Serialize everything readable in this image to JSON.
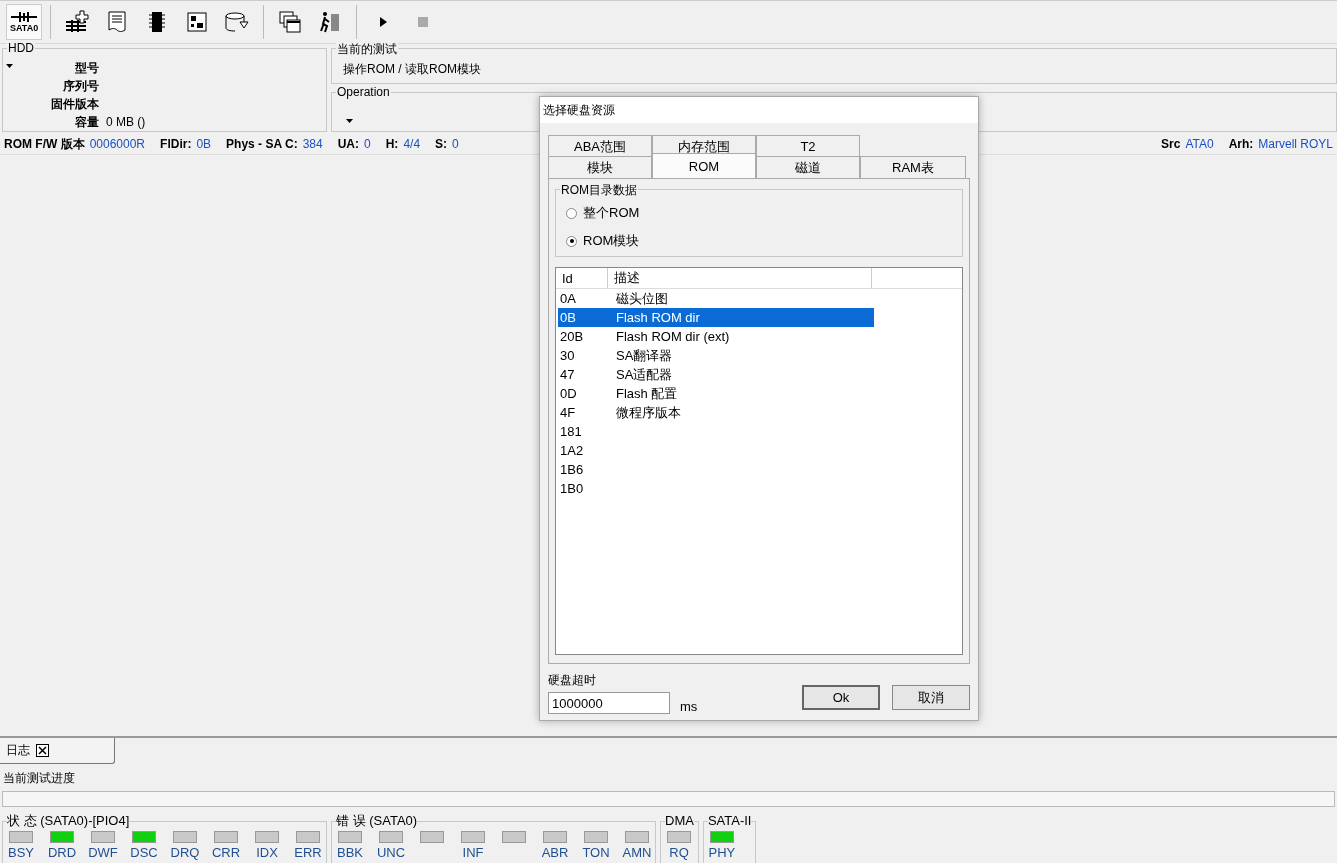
{
  "toolbar": {
    "port_label": "SATA0"
  },
  "hdd": {
    "title": "HDD",
    "fields": [
      {
        "label": "型号"
      },
      {
        "label": "序列号"
      },
      {
        "label": "固件版本"
      },
      {
        "label": "容量",
        "value": "0 MB ()"
      }
    ]
  },
  "current_test": {
    "title": "当前的测试",
    "value": "操作ROM / 读取ROM模块"
  },
  "operation": {
    "title": "Operation"
  },
  "info_bar": {
    "left": [
      {
        "label": "ROM F/W 版本",
        "value": "0006000R"
      },
      {
        "label": "FlDir:",
        "value": "0B"
      },
      {
        "label": "Phys - SA C:",
        "value": "384"
      },
      {
        "label": "UA:",
        "value": "0"
      },
      {
        "label": "H:",
        "value": "4/4"
      },
      {
        "label": "S:",
        "value": "0"
      }
    ],
    "right": [
      {
        "label": "Src",
        "value": "ATA0"
      },
      {
        "label": "Arh:",
        "value": "Marvell ROYL"
      }
    ]
  },
  "dialog": {
    "title": "选择硬盘资源",
    "tab_rows": [
      [
        {
          "label": "ABA范围",
          "selected": false
        },
        {
          "label": "内存范围",
          "selected": false
        },
        {
          "label": "T2",
          "selected": false
        }
      ],
      [
        {
          "label": "模块",
          "selected": false
        },
        {
          "label": "ROM",
          "selected": true
        },
        {
          "label": "磁道",
          "selected": false
        },
        {
          "label": "RAM表",
          "selected": false
        }
      ]
    ],
    "group": {
      "title": "ROM目录数据",
      "options": [
        {
          "label": "整个ROM",
          "selected": false
        },
        {
          "label": "ROM模块",
          "selected": true
        }
      ]
    },
    "list": {
      "columns": [
        "Id",
        "描述"
      ],
      "rows": [
        {
          "id": "0A",
          "desc": "磁头位图",
          "selected": false
        },
        {
          "id": "0B",
          "desc": "Flash ROM dir",
          "selected": true
        },
        {
          "id": "20B",
          "desc": "Flash ROM dir (ext)",
          "selected": false
        },
        {
          "id": "30",
          "desc": "SA翻译器",
          "selected": false
        },
        {
          "id": "47",
          "desc": "SA适配器",
          "selected": false
        },
        {
          "id": "0D",
          "desc": "Flash 配置",
          "selected": false
        },
        {
          "id": "4F",
          "desc": "微程序版本",
          "selected": false
        },
        {
          "id": "181",
          "selected": false
        },
        {
          "id": "1A2",
          "selected": false
        },
        {
          "id": "1B6",
          "selected": false
        },
        {
          "id": "1B0",
          "selected": false
        }
      ]
    },
    "timeout": {
      "label": "硬盘超时",
      "value": "1000000",
      "unit": "ms"
    },
    "buttons": [
      "Ok",
      "取消"
    ]
  },
  "log_tab": {
    "label": "日志"
  },
  "progress": {
    "label": "当前测试进度",
    "level": 0
  },
  "status_groups": [
    {
      "title": "状 态 (SATA0)-[PIO4]",
      "leds": [
        {
          "label": "BSY",
          "on": false
        },
        {
          "label": "DRD",
          "on": true
        },
        {
          "label": "DWF",
          "on": false
        },
        {
          "label": "DSC",
          "on": true
        },
        {
          "label": "DRQ",
          "on": false
        },
        {
          "label": "CRR",
          "on": false
        },
        {
          "label": "IDX",
          "on": false
        },
        {
          "label": "ERR",
          "on": false
        }
      ]
    },
    {
      "title": "错 误 (SATA0)",
      "leds": [
        {
          "label": "BBK",
          "on": false
        },
        {
          "label": "UNC",
          "on": false
        },
        {
          "on": false
        },
        {
          "label": "INF",
          "on": false
        },
        {
          "on": false
        },
        {
          "label": "ABR",
          "on": false
        },
        {
          "label": "TON",
          "on": false
        },
        {
          "label": "AMN",
          "on": false
        }
      ]
    },
    {
      "title": "DMA",
      "leds": [
        {
          "label": "RQ",
          "on": false
        }
      ]
    },
    {
      "title": "SATA-II",
      "leds": [
        {
          "label": "PHY",
          "on": true
        }
      ]
    }
  ]
}
